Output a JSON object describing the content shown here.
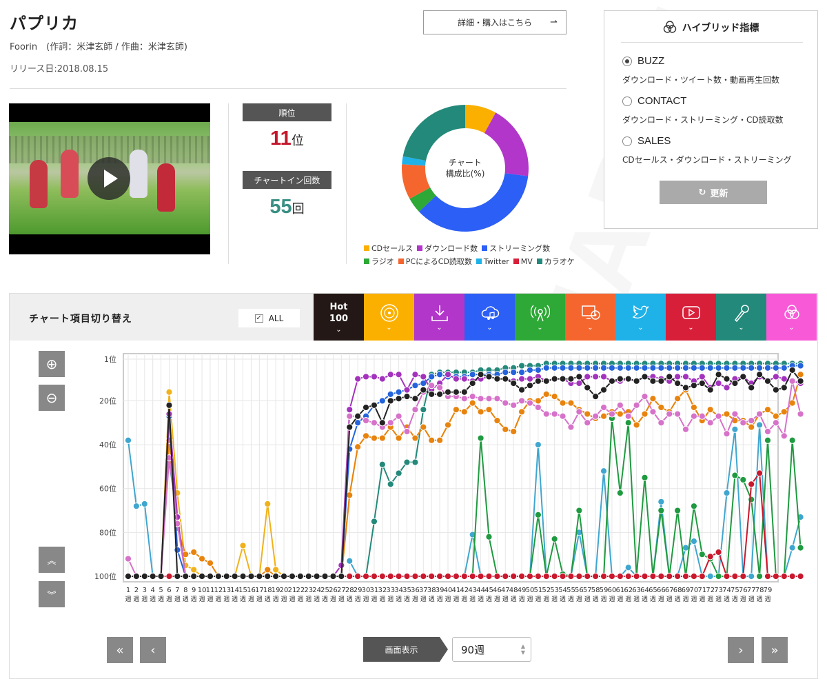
{
  "song": {
    "title": "パプリカ",
    "artist_line": "Foorin　(作詞：米津玄師 / 作曲：米津玄師)",
    "release": "リリース日:2018.08.15",
    "buy_label": "詳細・購入はこちら",
    "buy_arrow": "⇀"
  },
  "watermark": "JAPAN",
  "stats": {
    "rank_label": "順位",
    "rank_value": "11",
    "rank_unit": "位",
    "chartin_label": "チャートイン回数",
    "chartin_value": "55",
    "chartin_unit": "回"
  },
  "composition": {
    "center_line1": "チャート",
    "center_line2": "構成比(%)",
    "slices": [
      {
        "name": "CDセールス",
        "value": 8,
        "color": "#fbb000"
      },
      {
        "name": "ダウンロード数",
        "value": 19,
        "color": "#b136c9"
      },
      {
        "name": "ストリーミング数",
        "value": 36,
        "color": "#2c5ff5"
      },
      {
        "name": "ラジオ",
        "value": 4,
        "color": "#2ea836"
      },
      {
        "name": "PCによるCD読取数",
        "value": 9,
        "color": "#f5662f"
      },
      {
        "name": "Twitter",
        "value": 2,
        "color": "#1fb2e8"
      },
      {
        "name": "MV",
        "value": 0,
        "color": "#d81f3a"
      },
      {
        "name": "カラオケ",
        "value": 22,
        "color": "#23897a"
      }
    ]
  },
  "hybrid": {
    "title": "ハイブリッド指標",
    "options": [
      {
        "label": "BUZZ",
        "desc": "ダウンロード・ツイート数・動画再生回数",
        "selected": true
      },
      {
        "label": "CONTACT",
        "desc": "ダウンロード・ストリーミング・CD読取数",
        "selected": false
      },
      {
        "label": "SALES",
        "desc": "CDセールス・ダウンロード・ストリーミング",
        "selected": false
      }
    ],
    "update_label": "更新",
    "update_icon": "↻"
  },
  "switcher": {
    "title": "チャート項目切り替え",
    "all_label": "ALL",
    "categories": [
      {
        "icon": "hot100",
        "label": "Hot\n100",
        "color": "#231815"
      },
      {
        "icon": "cd-icon",
        "color": "#fbb000"
      },
      {
        "icon": "download-icon",
        "color": "#b136c9"
      },
      {
        "icon": "cloud-music-icon",
        "color": "#2c5ff5"
      },
      {
        "icon": "radio-icon",
        "color": "#2ea836"
      },
      {
        "icon": "pc-cd-icon",
        "color": "#f5662f"
      },
      {
        "icon": "twitter-icon",
        "color": "#1fb2e8"
      },
      {
        "icon": "video-icon",
        "color": "#d81f3a"
      },
      {
        "icon": "microphone-icon",
        "color": "#23897a"
      },
      {
        "icon": "hybrid-icon",
        "color": "#f85ad7"
      }
    ],
    "chevron": "⌄"
  },
  "chart_data": {
    "type": "line",
    "y_reversed": true,
    "ylim": [
      1,
      100
    ],
    "y_ticks": [
      "1位",
      "20位",
      "40位",
      "60位",
      "80位",
      "100位"
    ],
    "x_labels": [
      "1",
      "2",
      "3",
      "4",
      "5",
      "6",
      "7",
      "8",
      "9",
      "10",
      "11",
      "12",
      "13",
      "14",
      "15",
      "16",
      "17",
      "18",
      "19",
      "20",
      "21",
      "22",
      "23",
      "24",
      "25",
      "26",
      "27",
      "28",
      "29",
      "30",
      "31",
      "32",
      "33",
      "34",
      "35",
      "36",
      "37",
      "38",
      "39",
      "40",
      "41",
      "42",
      "43",
      "44",
      "45",
      "46",
      "47",
      "48",
      "49",
      "50",
      "51",
      "52",
      "53",
      "54",
      "55",
      "56",
      "57",
      "58",
      "59",
      "60",
      "61",
      "62",
      "63",
      "64",
      "65",
      "66",
      "67",
      "68",
      "69",
      "70",
      "71",
      "72",
      "73",
      "74",
      "75",
      "76",
      "77",
      "78",
      "79"
    ],
    "x_suffix": "週",
    "series": [
      {
        "key": "twitter",
        "color": "#3fa6cf",
        "values": [
          38,
          68,
          67,
          100,
          null,
          48,
          73,
          100,
          null,
          null,
          null,
          null,
          null,
          null,
          null,
          null,
          null,
          null,
          null,
          null,
          null,
          null,
          null,
          null,
          null,
          null,
          null,
          93,
          100,
          100,
          100,
          100,
          100,
          100,
          100,
          100,
          100,
          100,
          100,
          100,
          100,
          100,
          81,
          100,
          100,
          100,
          100,
          100,
          100,
          100,
          40,
          100,
          100,
          100,
          100,
          80,
          100,
          100,
          52,
          100,
          100,
          96,
          100,
          100,
          100,
          66,
          100,
          100,
          87,
          84,
          100,
          100,
          100,
          62,
          33,
          100,
          100,
          31,
          100,
          100,
          100,
          87,
          73
        ]
      },
      {
        "key": "radio",
        "color": "#1f9a40",
        "values": [
          100,
          100,
          100,
          100,
          100,
          100,
          100,
          100,
          100,
          100,
          100,
          100,
          100,
          100,
          100,
          100,
          100,
          100,
          100,
          100,
          100,
          100,
          100,
          100,
          100,
          100,
          100,
          100,
          100,
          100,
          100,
          100,
          100,
          100,
          100,
          100,
          100,
          100,
          100,
          100,
          100,
          100,
          100,
          37,
          82,
          100,
          100,
          100,
          100,
          100,
          72,
          100,
          83,
          99,
          100,
          70,
          100,
          100,
          100,
          28,
          62,
          30,
          100,
          55,
          100,
          70,
          100,
          70,
          100,
          68,
          90,
          92,
          100,
          100,
          54,
          56,
          65,
          100,
          38,
          100,
          100,
          38,
          87
        ]
      },
      {
        "key": "karaoke",
        "color": "#23897a",
        "values": [
          100,
          100,
          100,
          100,
          100,
          100,
          100,
          100,
          100,
          100,
          100,
          100,
          100,
          100,
          100,
          100,
          100,
          100,
          100,
          100,
          100,
          100,
          100,
          100,
          100,
          100,
          100,
          100,
          100,
          100,
          75,
          49,
          58,
          53,
          48,
          48,
          24,
          8,
          7,
          7,
          7,
          7,
          7,
          6,
          6,
          6,
          5,
          5,
          4,
          4,
          4,
          3,
          3,
          3,
          3,
          3,
          3,
          3,
          3,
          3,
          3,
          3,
          3,
          3,
          3,
          3,
          3,
          3,
          3,
          3,
          3,
          3,
          3,
          3,
          3,
          3,
          3,
          3,
          3,
          3,
          3,
          3,
          3
        ]
      },
      {
        "key": "cd",
        "color": "#f0b21b",
        "values": [
          100,
          100,
          100,
          100,
          100,
          16,
          62,
          95,
          97,
          100,
          100,
          100,
          100,
          100,
          86,
          100,
          100,
          67,
          97,
          100,
          100,
          100,
          100,
          100,
          100,
          100,
          100,
          63,
          41,
          36,
          37,
          37,
          32,
          37,
          32,
          37,
          32,
          38,
          38,
          31,
          24,
          25,
          21,
          25,
          24,
          29,
          33,
          34,
          25,
          20,
          20,
          17,
          18,
          21,
          21,
          24,
          26,
          28,
          27,
          25,
          26,
          25,
          31,
          26,
          19,
          23,
          25,
          19,
          15,
          23,
          29,
          24,
          27,
          26,
          29,
          29,
          32,
          26,
          24,
          27,
          25,
          21,
          8
        ]
      },
      {
        "key": "pc-cd",
        "color": "#e8830e",
        "values": [
          100,
          100,
          100,
          100,
          100,
          38,
          78,
          90,
          89,
          92,
          94,
          100,
          100,
          100,
          100,
          100,
          100,
          97,
          100,
          100,
          100,
          100,
          100,
          100,
          100,
          100,
          100,
          63,
          41,
          36,
          37,
          37,
          32,
          37,
          32,
          37,
          32,
          38,
          38,
          31,
          24,
          25,
          21,
          25,
          24,
          29,
          33,
          34,
          25,
          20,
          20,
          17,
          18,
          21,
          21,
          24,
          26,
          28,
          27,
          25,
          26,
          25,
          31,
          26,
          19,
          23,
          25,
          19,
          15,
          23,
          29,
          24,
          27,
          26,
          29,
          29,
          32,
          26,
          24,
          27,
          25,
          21,
          8
        ]
      },
      {
        "key": "streaming",
        "color": "#2463db",
        "values": [
          100,
          100,
          100,
          100,
          100,
          27,
          88,
          100,
          100,
          100,
          100,
          100,
          100,
          100,
          100,
          100,
          100,
          100,
          100,
          100,
          100,
          100,
          100,
          100,
          100,
          100,
          100,
          42,
          30,
          27,
          22,
          20,
          17,
          16,
          15,
          13,
          12,
          9,
          8,
          9,
          9,
          9,
          8,
          8,
          8,
          8,
          7,
          7,
          7,
          6,
          6,
          5,
          5,
          5,
          5,
          5,
          5,
          5,
          5,
          5,
          5,
          5,
          5,
          5,
          5,
          5,
          5,
          5,
          5,
          5,
          5,
          5,
          5,
          5,
          5,
          5,
          5,
          5,
          5,
          5,
          5,
          4,
          4
        ]
      },
      {
        "key": "download",
        "color": "#a333bd",
        "values": [
          100,
          100,
          100,
          100,
          100,
          26,
          73,
          100,
          100,
          100,
          100,
          100,
          100,
          100,
          100,
          100,
          100,
          100,
          100,
          100,
          100,
          100,
          100,
          100,
          100,
          100,
          95,
          24,
          10,
          9,
          9,
          10,
          8,
          8,
          15,
          8,
          9,
          15,
          12,
          8,
          10,
          10,
          11,
          10,
          9,
          10,
          10,
          11,
          10,
          10,
          9,
          11,
          10,
          10,
          12,
          12,
          9,
          9,
          9,
          11,
          11,
          10,
          11,
          9,
          9,
          10,
          11,
          9,
          9,
          11,
          9,
          14,
          12,
          14,
          10,
          9,
          12,
          9,
          11,
          9,
          10,
          11,
          12
        ]
      },
      {
        "key": "hybrid",
        "color": "#d672c9",
        "values": [
          92,
          100,
          100,
          100,
          100,
          46,
          76,
          100,
          100,
          100,
          100,
          100,
          100,
          100,
          100,
          100,
          100,
          100,
          100,
          100,
          100,
          100,
          100,
          100,
          100,
          100,
          100,
          27,
          27,
          29,
          30,
          32,
          30,
          27,
          34,
          24,
          16,
          13,
          14,
          18,
          18,
          19,
          18,
          19,
          19,
          19,
          21,
          22,
          20,
          21,
          23,
          26,
          26,
          27,
          32,
          25,
          30,
          27,
          23,
          26,
          22,
          27,
          22,
          18,
          25,
          30,
          26,
          26,
          33,
          27,
          27,
          30,
          27,
          35,
          26,
          30,
          29,
          26,
          34,
          30,
          36,
          11,
          26
        ]
      },
      {
        "key": "mv",
        "color": "#c9182d",
        "values": [
          100,
          100,
          100,
          100,
          100,
          100,
          100,
          100,
          100,
          100,
          100,
          100,
          100,
          100,
          100,
          100,
          100,
          100,
          100,
          100,
          100,
          100,
          100,
          100,
          100,
          100,
          100,
          100,
          100,
          100,
          100,
          100,
          100,
          100,
          100,
          100,
          100,
          100,
          100,
          100,
          100,
          100,
          100,
          100,
          100,
          100,
          100,
          100,
          100,
          100,
          100,
          100,
          100,
          100,
          100,
          100,
          100,
          100,
          100,
          100,
          100,
          100,
          100,
          100,
          100,
          100,
          100,
          100,
          100,
          100,
          100,
          91,
          89,
          100,
          100,
          100,
          58,
          53,
          100,
          100,
          100,
          100,
          100
        ]
      },
      {
        "key": "hot100",
        "color": "#222222",
        "values": [
          100,
          100,
          100,
          100,
          100,
          22,
          100,
          100,
          100,
          100,
          100,
          100,
          100,
          100,
          100,
          100,
          100,
          100,
          100,
          100,
          100,
          100,
          100,
          100,
          100,
          100,
          100,
          32,
          27,
          23,
          22,
          30,
          20,
          19,
          18,
          19,
          15,
          17,
          17,
          16,
          16,
          16,
          12,
          8,
          9,
          10,
          10,
          12,
          15,
          13,
          11,
          11,
          10,
          10,
          10,
          9,
          14,
          18,
          15,
          11,
          10,
          10,
          11,
          9,
          11,
          11,
          9,
          12,
          14,
          13,
          12,
          15,
          8,
          10,
          12,
          9,
          14,
          8,
          11,
          15,
          14,
          6,
          11
        ]
      }
    ]
  },
  "nav": {
    "first": "«",
    "prev": "‹",
    "next": "›",
    "last": "»",
    "display_label": "画面表示",
    "weeks_value": "90週",
    "zoom_in": "⊕",
    "zoom_out": "⊖",
    "scroll_up": "⌃⌃",
    "scroll_down": "⌄⌄"
  }
}
